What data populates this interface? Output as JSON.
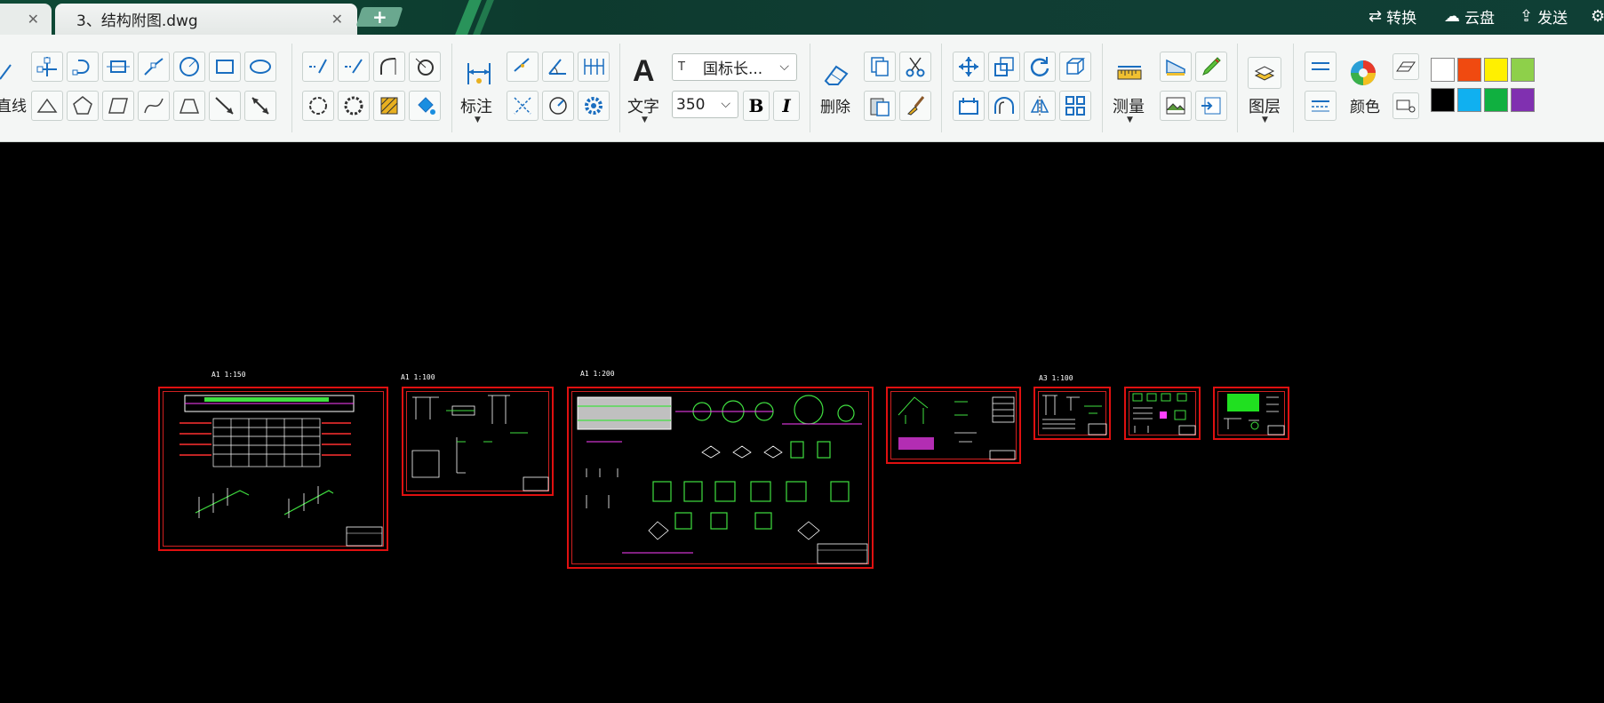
{
  "titlebar": {
    "tabs": [
      {
        "label": "",
        "active": false
      },
      {
        "label": "3、结构附图.dwg",
        "active": true
      }
    ],
    "new_tab_symbol": "+",
    "close_symbol": "✕",
    "actions": [
      {
        "label": "转换",
        "icon": "convert-icon"
      },
      {
        "label": "云盘",
        "icon": "cloud-icon"
      },
      {
        "label": "发送",
        "icon": "send-icon"
      }
    ]
  },
  "ribbon": {
    "partial_label": "直线",
    "dimension_label": "标注",
    "text_label": "文字",
    "font_dropdown": "国标长...",
    "size_dropdown": "350",
    "bold_label": "B",
    "italic_label": "I",
    "delete_label": "删除",
    "measure_label": "测量",
    "layer_label": "图层",
    "color_label": "颜色",
    "text_icon_glyph": "A",
    "font_icon_glyph": "T",
    "colors": [
      "#ffffff",
      "#f04a10",
      "#fff000",
      "#8ed04a",
      "#000000",
      "#10b0f0",
      "#10b040",
      "#8030b0"
    ]
  },
  "canvas": {
    "sheet_titles": [
      "A1 1:150",
      "A1 1:100",
      "A1 1:200",
      "A3 1:100"
    ]
  }
}
